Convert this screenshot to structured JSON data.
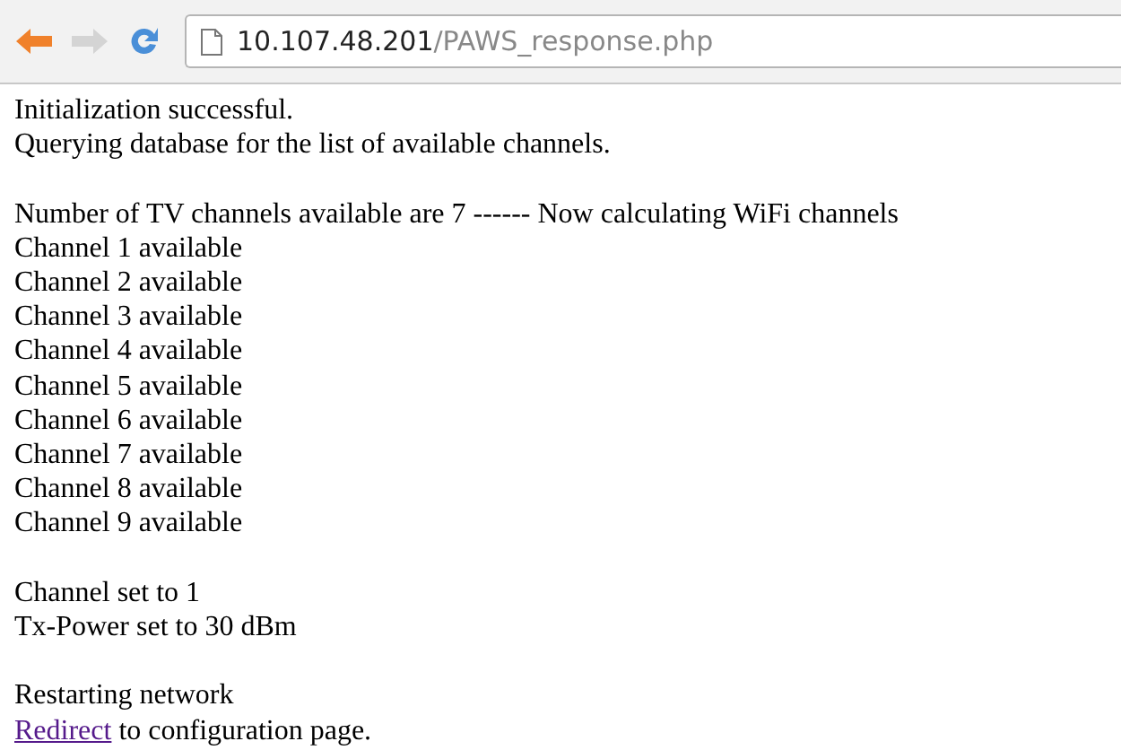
{
  "toolbar": {
    "back": {
      "disabled": false
    },
    "forward": {
      "disabled": true
    },
    "address": {
      "host": "10.107.48.201",
      "path": "/PAWS_response.php"
    }
  },
  "blocks": [
    [
      "Initialization successful.",
      "Querying database for the list of available channels."
    ],
    [
      "Number of TV channels available are 7 ------ Now calculating WiFi channels",
      "Channel 1 available",
      "Channel 2 available",
      "Channel 3 available",
      "Channel 4 available",
      "Channel 5 available",
      "Channel 6 available",
      "Channel 7 available",
      "Channel 8 available",
      "Channel 9 available"
    ],
    [
      "Channel set to 1",
      "Tx-Power set to 30 dBm"
    ],
    [
      "Restarting network"
    ]
  ],
  "final_line": {
    "link": "Redirect",
    "text": " to configuration page."
  }
}
